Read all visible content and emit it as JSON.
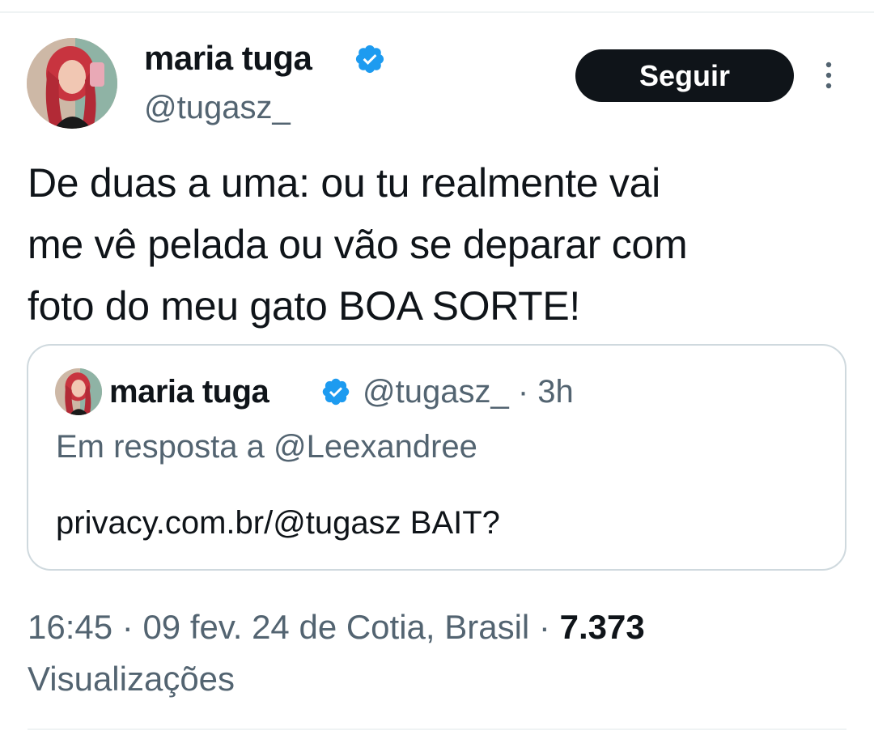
{
  "author": {
    "display_name": "maria tuga",
    "handle": "@tugasz_",
    "verified_icon": "verified-badge-icon",
    "verified_color": "#1d9bf0"
  },
  "follow_button": {
    "label": "Seguir"
  },
  "more_menu": {
    "icon": "more-vertical-icon"
  },
  "tweet": {
    "text": "De duas a uma: ou tu realmente vai\nme vê pelada ou vão se deparar com\nfoto do meu gato BOA SORTE!"
  },
  "quoted_tweet": {
    "display_name": "maria tuga",
    "handle": "@tugasz_",
    "separator": " · ",
    "time": "3h",
    "reply_to": "Em resposta a @Leexandree",
    "text": "privacy.com.br/@tugasz BAIT?"
  },
  "meta": {
    "time": "16:45",
    "date": "09 fev. 24",
    "location": "de Cotia, Brasil",
    "separator": " · ",
    "views_count": "7.373",
    "views_label": "Visualizações"
  },
  "colors": {
    "text_primary": "#0f1419",
    "text_secondary": "#536471",
    "border": "#cfd9de",
    "divider": "#eff3f4",
    "accent": "#1d9bf0"
  }
}
